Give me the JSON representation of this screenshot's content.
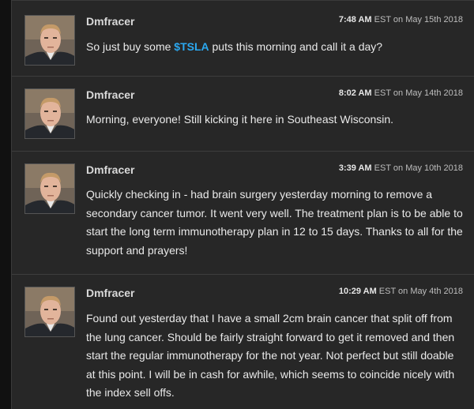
{
  "posts": [
    {
      "username": "Dmfracer",
      "time": "7:48 AM",
      "date_text": "EST on May 15th 2018",
      "text_before": "So just buy some ",
      "ticker": "$TSLA",
      "text_after": " puts this morning and call it a day?"
    },
    {
      "username": "Dmfracer",
      "time": "8:02 AM",
      "date_text": "EST on May 14th 2018",
      "text": "Morning, everyone! Still kicking it here in Southeast Wisconsin."
    },
    {
      "username": "Dmfracer",
      "time": "3:39 AM",
      "date_text": "EST on May 10th 2018",
      "text": "Quickly checking in - had brain surgery yesterday morning to remove a secondary cancer tumor. It went very well. The treatment plan is to be able to start the long term immunotherapy plan in 12 to 15 days. Thanks to all for the support and prayers!"
    },
    {
      "username": "Dmfracer",
      "time": "10:29 AM",
      "date_text": "EST on May 4th 2018",
      "text": "Found out yesterday that I have a small 2cm brain cancer that split off from the lung cancer. Should be fairly straight forward to get it removed and then start the regular immunotherapy for the not year. Not perfect but still doable at this point. I will be in cash for awhile, which seems to coincide nicely with the index sell offs."
    }
  ],
  "colors": {
    "background": "#272727",
    "ticker": "#2ba8f0",
    "divider": "#3d3d3d"
  }
}
